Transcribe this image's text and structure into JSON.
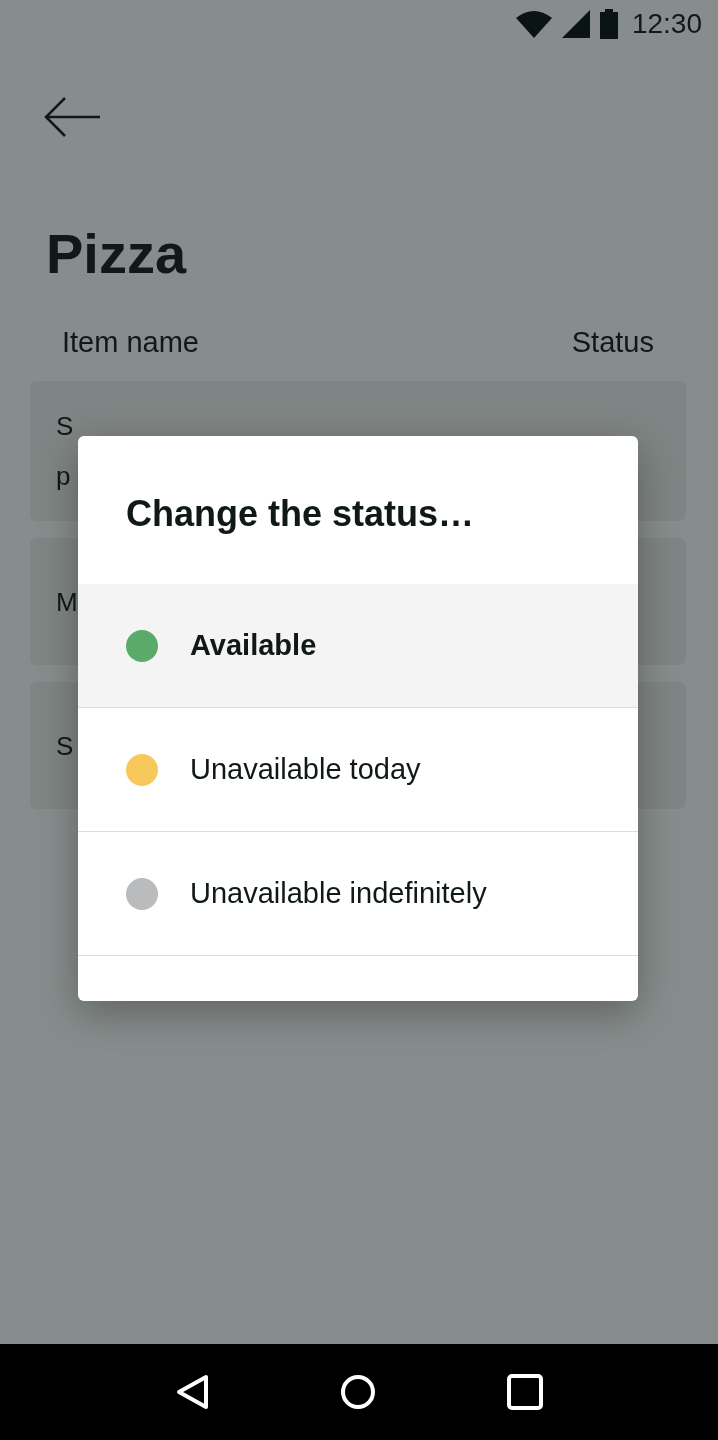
{
  "status_bar": {
    "time": "12:30"
  },
  "header": {
    "title": "Pizza"
  },
  "table": {
    "columns": [
      "Item name",
      "Status"
    ],
    "rows": [
      {
        "lines": [
          "S",
          "p"
        ]
      },
      {
        "lines": [
          "M"
        ]
      },
      {
        "lines": [
          "S"
        ]
      }
    ]
  },
  "dialog": {
    "title": "Change the status…",
    "options": [
      {
        "label": "Available",
        "color": "#5aab6a",
        "selected": true
      },
      {
        "label": "Unavailable today",
        "color": "#f6c95a",
        "selected": false
      },
      {
        "label": "Unavailable indefinitely",
        "color": "#b9bbbc",
        "selected": false
      }
    ]
  }
}
